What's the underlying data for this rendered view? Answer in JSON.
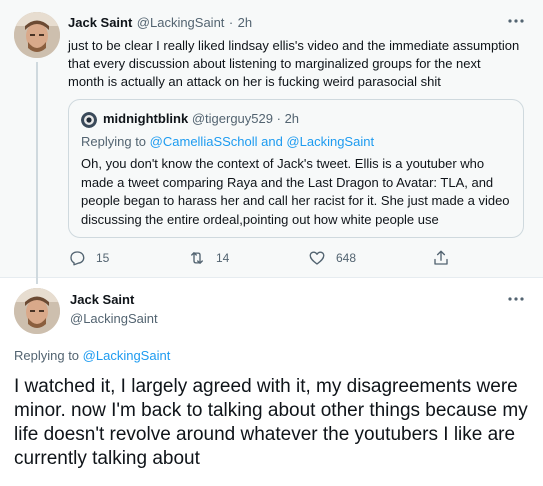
{
  "parent_tweet": {
    "author_name": "Jack Saint",
    "author_handle": "@LackingSaint",
    "separator": "·",
    "time": "2h",
    "text": "just to be clear I really liked lindsay ellis's video and the immediate assumption that every discussion about listening to marginalized groups for the next month is actually an attack on her is fucking weird parasocial shit",
    "quote": {
      "author_name": "midnightblink",
      "author_handle": "@tigerguy529",
      "separator": "·",
      "time": "2h",
      "replying_label": "Replying to",
      "replying_handles": "@CamelliaSScholl and @LackingSaint",
      "text": "Oh, you don't know the context of Jack's tweet. Ellis is a youtuber who made a tweet comparing Raya and the Last Dragon to Avatar: TLA, and people began to harass her and call her racist for it. She just made a video discussing the entire ordeal,pointing out how white people use"
    },
    "actions": {
      "replies": "15",
      "retweets": "14",
      "likes": "648"
    }
  },
  "reply_tweet": {
    "author_name": "Jack Saint",
    "author_handle": "@LackingSaint",
    "replying_label": "Replying to",
    "replying_handle": "@LackingSaint",
    "text": "I watched it, I largely agreed with it, my disagreements were minor. now I'm back to talking about other things because my life doesn't revolve around whatever the youtubers I like are currently talking about"
  },
  "icons": {
    "more": "more-horizontal-icon",
    "reply": "reply-icon",
    "retweet": "retweet-icon",
    "like": "heart-icon",
    "share": "share-icon"
  },
  "colors": {
    "link": "#1d9bf0",
    "muted": "#536471",
    "text": "#0f1419",
    "thread_line": "#cfd9de",
    "parent_background": "#f7f9f9"
  }
}
